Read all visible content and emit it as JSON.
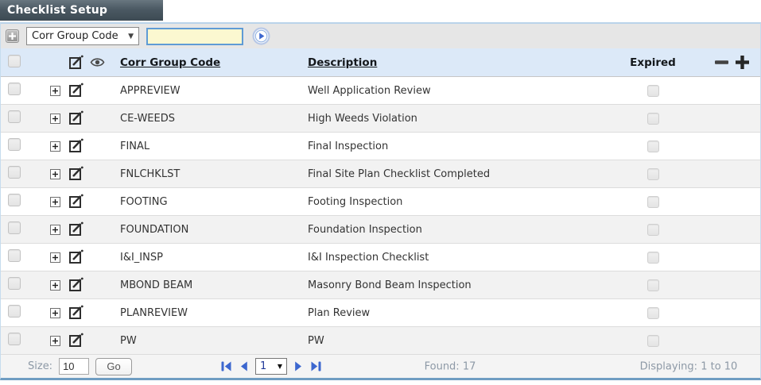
{
  "window": {
    "title": "Checklist Setup"
  },
  "toolbar": {
    "field_select": {
      "value": "Corr Group Code"
    },
    "search_input": {
      "value": "",
      "placeholder": ""
    }
  },
  "table": {
    "headers": {
      "code": "Corr Group Code",
      "description": "Description",
      "expired": "Expired"
    },
    "rows": [
      {
        "code": "APPREVIEW",
        "description": "Well Application Review",
        "expired": false
      },
      {
        "code": "CE-WEEDS",
        "description": "High Weeds Violation",
        "expired": false
      },
      {
        "code": "FINAL",
        "description": "Final Inspection",
        "expired": false
      },
      {
        "code": "FNLCHKLST",
        "description": "Final Site Plan Checklist Completed",
        "expired": false
      },
      {
        "code": "FOOTING",
        "description": "Footing Inspection",
        "expired": false
      },
      {
        "code": "FOUNDATION",
        "description": "Foundation Inspection",
        "expired": false
      },
      {
        "code": "I&I_INSP",
        "description": "I&I Inspection Checklist",
        "expired": false
      },
      {
        "code": "MBOND BEAM",
        "description": "Masonry Bond Beam Inspection",
        "expired": false
      },
      {
        "code": "PLANREVIEW",
        "description": "Plan Review",
        "expired": false
      },
      {
        "code": "PW",
        "description": "PW",
        "expired": false
      }
    ]
  },
  "footer": {
    "size_label": "Size:",
    "size_value": "10",
    "go_label": "Go",
    "page_value": "1",
    "found_text": "Found: 17",
    "displaying_text": "Displaying: 1 to 10"
  },
  "icons": {
    "toolbar_add": "plus-icon",
    "toolbar_submit": "circle-arrow-right-icon",
    "header_edit": "edit-pencil-icon",
    "header_view": "eye-icon",
    "column_remove": "minus-icon",
    "column_add": "plus-icon",
    "pager": [
      "first-page-icon",
      "previous-page-icon",
      "next-page-icon",
      "last-page-icon"
    ]
  },
  "colors": {
    "title_bar": "#4b5963",
    "panel_border": "#b9d3ea",
    "header_bg": "#dce9f8",
    "alt_row_bg": "#f2f2f2",
    "accent_blue": "#3c67cf",
    "search_input_bg": "#fbf8d0",
    "footer_bottom_border": "#6f9dc2",
    "muted_text": "#8d99a6"
  }
}
